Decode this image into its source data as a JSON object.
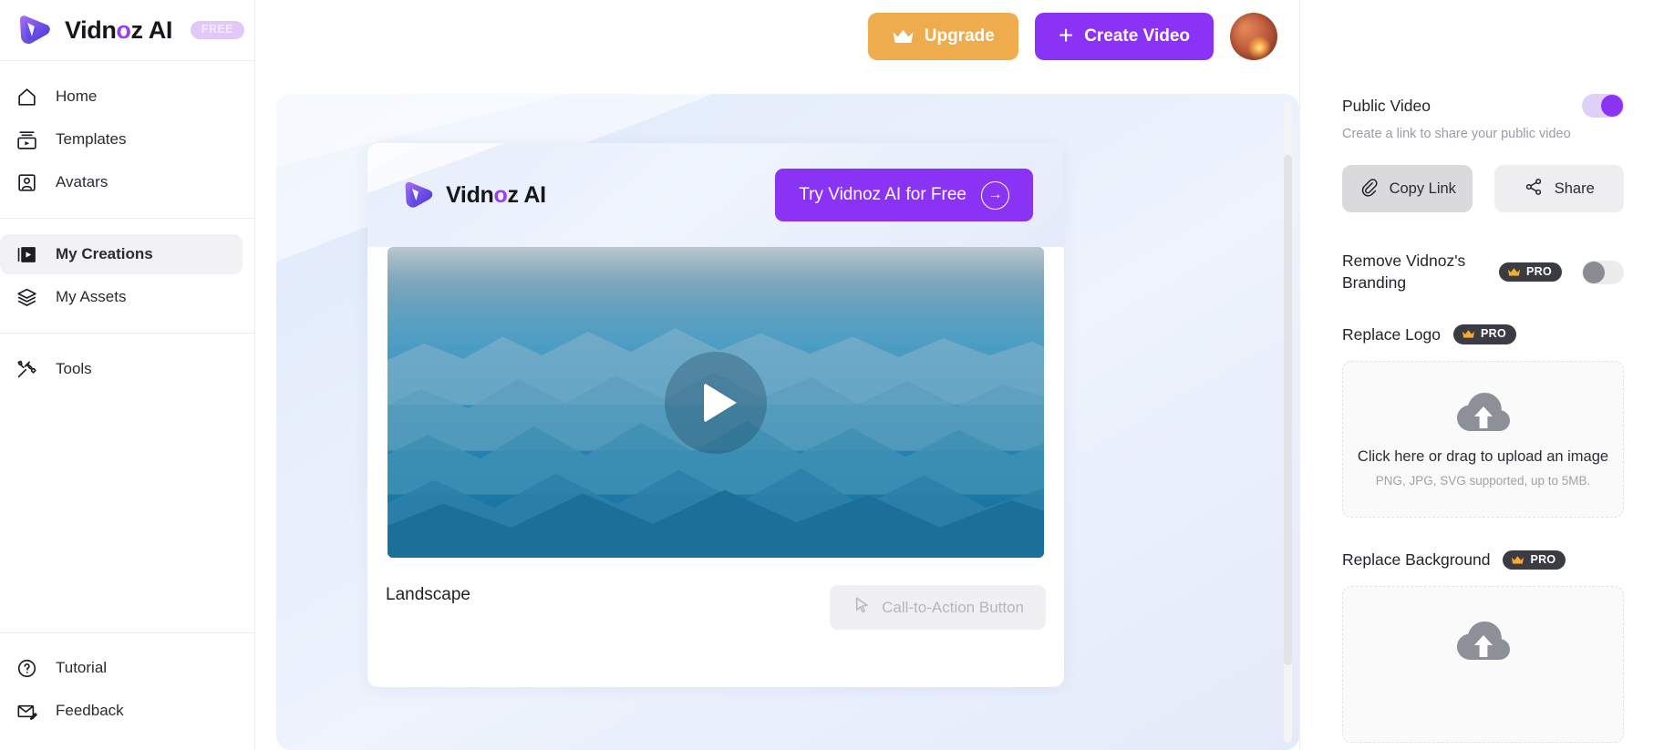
{
  "brand": {
    "name_pre": "Vidn",
    "name_mid": "o",
    "name_post": "z AI",
    "badge": "FREE",
    "logo_icon": "vidnoz-v-logo-icon"
  },
  "sidebar": {
    "groups": [
      {
        "items": [
          {
            "label": "Home",
            "icon": "home-icon"
          },
          {
            "label": "Templates",
            "icon": "templates-icon"
          },
          {
            "label": "Avatars",
            "icon": "avatars-icon"
          }
        ]
      },
      {
        "items": [
          {
            "label": "My Creations",
            "icon": "my-creations-icon",
            "active": true
          },
          {
            "label": "My Assets",
            "icon": "my-assets-layers-icon"
          }
        ]
      },
      {
        "items": [
          {
            "label": "Tools",
            "icon": "tools-wrench-icon"
          }
        ]
      }
    ],
    "bottom_items": [
      {
        "label": "Tutorial",
        "icon": "question-circle-icon"
      },
      {
        "label": "Feedback",
        "icon": "envelope-edit-icon"
      }
    ]
  },
  "topbar": {
    "upgrade_label": "Upgrade",
    "upgrade_icon": "crown-icon",
    "upgrade_color": "#eeac4c",
    "create_label": "Create Video",
    "create_icon": "plus-icon",
    "create_color": "#8b33f5",
    "avatar_icon": "user-avatar"
  },
  "video_card": {
    "brand_pre": "Vidn",
    "brand_mid": "o",
    "brand_post": "z AI",
    "try_label": "Try Vidnoz AI for Free",
    "try_arrow_icon": "arrow-right-circle-icon",
    "play_icon": "play-icon",
    "thumbnail_alt": "mountain landscape",
    "title": "Landscape",
    "cta_label": "Call-to-Action Button",
    "cta_icon": "cursor-pointer-icon"
  },
  "panel": {
    "public_video": {
      "label": "Public Video",
      "toggle_state": "on",
      "description": "Create a link to share your public video",
      "copy_link_label": "Copy Link",
      "copy_link_icon": "paperclip-icon",
      "share_label": "Share",
      "share_icon": "share-nodes-icon"
    },
    "remove_branding": {
      "label": "Remove Vidnoz's Branding",
      "pro_badge": "PRO",
      "toggle_state": "off"
    },
    "replace_logo": {
      "label": "Replace Logo",
      "pro_badge": "PRO",
      "upload_icon": "cloud-upload-icon",
      "upload_main": "Click here or drag to upload an image",
      "upload_sub": "PNG, JPG, SVG supported, up to 5MB."
    },
    "replace_background": {
      "label": "Replace Background",
      "pro_badge": "PRO",
      "upload_icon": "cloud-upload-icon"
    },
    "pro_badge_bg": "#3b3c43",
    "accent": "#8b33f5"
  },
  "scrollbar": {
    "icon": "vertical-scrollbar"
  }
}
